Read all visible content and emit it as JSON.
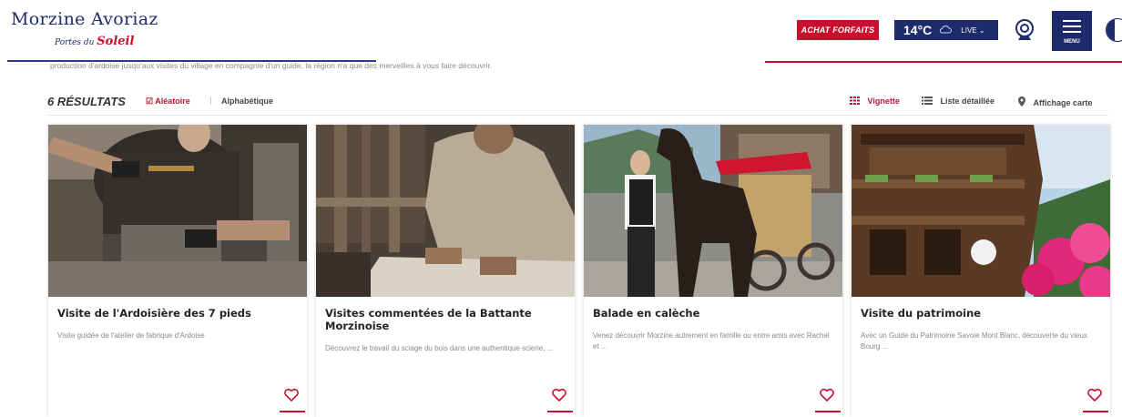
{
  "header": {
    "logo_title": "Morzine Avoriaz",
    "logo_subtitle_a": "Portes du ",
    "logo_subtitle_b": "Soleil",
    "btn_forfaits": "ACHAT FORFAITS",
    "weather_temp": "14°C",
    "weather_live": "LIVE",
    "menu_label": "MENU"
  },
  "intro_text": "production d'ardoise jusqu'aux visites du village en compagnie d'un guide, la région n'a que des merveilles à vous faire découvrir.",
  "results": {
    "count": "6 RÉSULTATS",
    "sort_random": "Aléatoire",
    "separator": "|",
    "sort_alpha": "Alphabétique",
    "view_grid": "Vignette",
    "view_list": "Liste détaillée",
    "view_map": "Affichage carte"
  },
  "colors": {
    "brand_red": "#c8102e",
    "brand_navy": "#1d2a6b"
  },
  "cards": [
    {
      "title": "Visite de l'Ardoisière des 7 pieds",
      "desc": "Visite guidée de l'atelier de fabrique d'Ardoise"
    },
    {
      "title": "Visites commentées de la Battante Morzinoise",
      "desc": "Découvrez le travail du sciage du bois dans une authentique scierie, ..."
    },
    {
      "title": "Balade en calèche",
      "desc": "Venez découvrir Morzine autrement en famille ou entre amis avec Rachel et ..."
    },
    {
      "title": "Visite du patrimoine",
      "desc": "Avec un Guide du Patrimoine Savoie Mont Blanc, découverte du vieux Bourg ..."
    }
  ]
}
